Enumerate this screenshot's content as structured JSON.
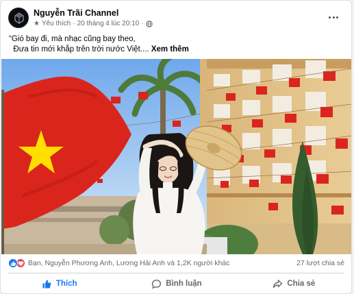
{
  "post": {
    "page_name": "Nguyễn Trãi Channel",
    "meta": {
      "badge_icon": "star-icon",
      "badge_label": "Yêu thích",
      "separator": "·",
      "date": "20 tháng 4 lúc 20:10",
      "separator2": "·",
      "audience_icon": "globe-icon"
    },
    "more_icon": "more-options-icon",
    "caption_line1": "“Gió bay đi, mà nhạc cũng bay theo,",
    "caption_line2": "  Đưa tin mới khắp trên trời nước Việt....",
    "see_more": "Xem thêm",
    "media_description_icon": "video-thumbnail"
  },
  "engagement": {
    "reaction_icons": [
      "like-icon",
      "love-icon"
    ],
    "reactions_text": "Bạn, Nguyễn Phương Anh, Lương Hải Anh và 1,2K người khác",
    "shares_text": "27 lượt chia sẻ"
  },
  "actions": {
    "like_label": "Thích",
    "comment_label": "Bình luận",
    "share_label": "Chia sẻ"
  },
  "colors": {
    "accent": "#1877f2",
    "muted_text": "#65676b",
    "flag_red": "#da251d",
    "flag_star": "#ffde00",
    "love": "#f33e58"
  }
}
